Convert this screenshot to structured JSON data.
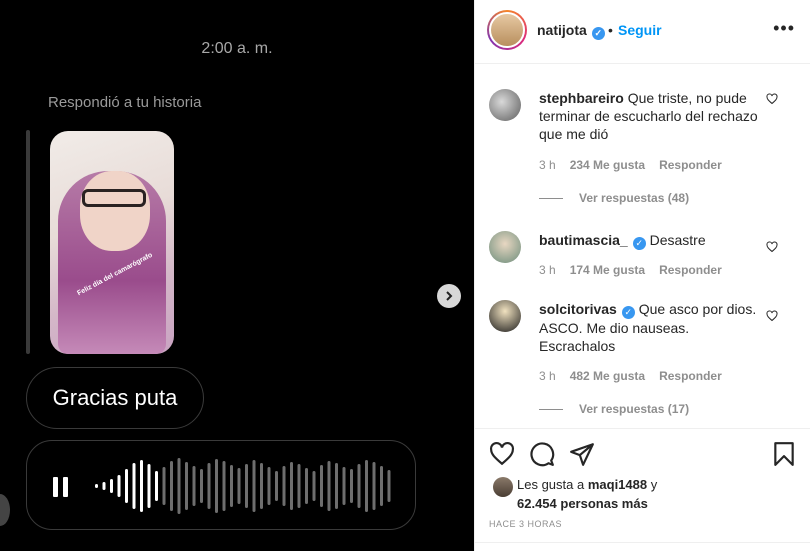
{
  "media": {
    "time": "2:00 a. m.",
    "replied_label": "Respondió a tu historia",
    "story_caption": "Feliz día del camarógrafo",
    "message": "Gracias puta"
  },
  "header": {
    "username": "natijota",
    "follow_label": "Seguir",
    "more_label": "•••"
  },
  "comments": [
    {
      "username": "stephbareiro",
      "verified": false,
      "text": "Que triste, no pude terminar de escucharlo del rechazo que me dió",
      "time": "3 h",
      "likes": "234 Me gusta",
      "reply_label": "Responder",
      "view_replies": "Ver respuestas (48)"
    },
    {
      "username": "bautimascia_",
      "verified": true,
      "text": "Desastre",
      "time": "3 h",
      "likes": "174 Me gusta",
      "reply_label": "Responder"
    },
    {
      "username": "solcitorivas",
      "verified": true,
      "text": "Que asco por dios. ASCO. Me dio nauseas. Escrachalos",
      "time": "3 h",
      "likes": "482 Me gusta",
      "reply_label": "Responder",
      "view_replies": "Ver respuestas (17)"
    }
  ],
  "likes": {
    "prefix": "Les gusta a",
    "user": "maqi1488",
    "and": "y",
    "others": "62.454 personas más"
  },
  "time_ago": "HACE 3 HORAS",
  "colors": {
    "accent": "#0095f6",
    "verified": "#3897f0",
    "media_bg": "#000000"
  }
}
